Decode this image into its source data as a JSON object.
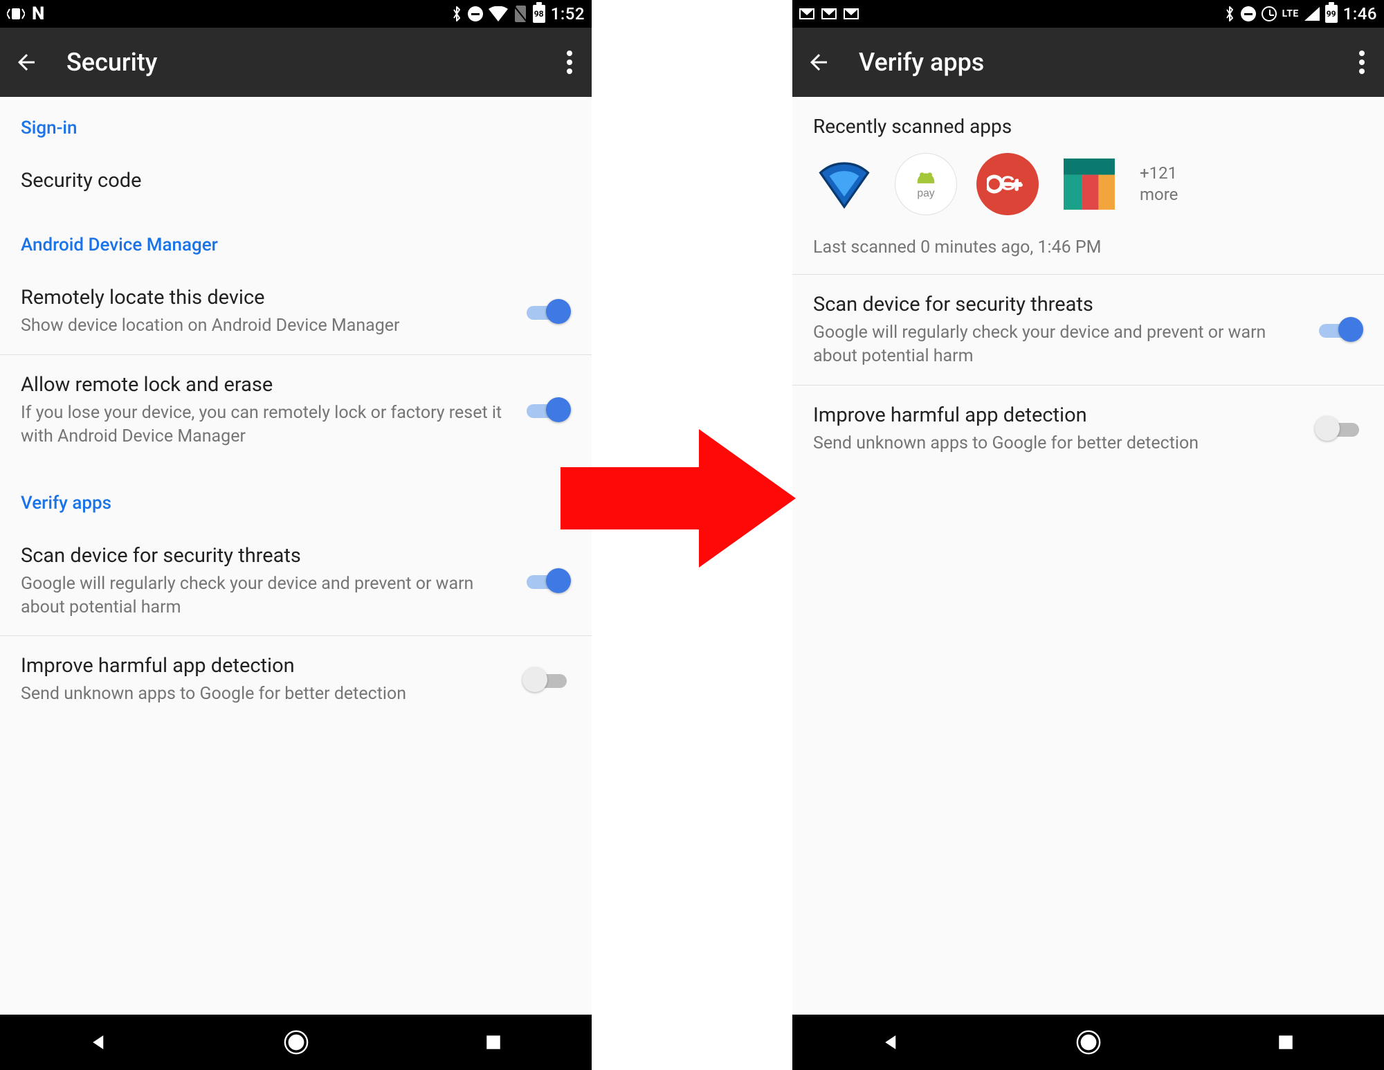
{
  "left": {
    "status": {
      "time": "1:52",
      "battery_pct": "98"
    },
    "title": "Security",
    "sections": {
      "signin_header": "Sign-in",
      "security_code": "Security code",
      "adm_header": "Android Device Manager",
      "remote_locate_title": "Remotely locate this device",
      "remote_locate_sub": "Show device location on Android Device Manager",
      "remote_lock_title": "Allow remote lock and erase",
      "remote_lock_sub": "If you lose your device, you can remotely lock or factory reset it with Android Device Manager",
      "verify_header": "Verify apps",
      "scan_title": "Scan device for security threats",
      "scan_sub": "Google will regularly check your device and prevent or warn about potential harm",
      "improve_title": "Improve harmful app detection",
      "improve_sub": "Send unknown apps to Google for better detection"
    }
  },
  "right": {
    "status": {
      "time": "1:46",
      "battery_pct": "99",
      "network": "LTE"
    },
    "title": "Verify apps",
    "recent_header": "Recently scanned apps",
    "more_apps_count": "+121",
    "more_apps_label": "more",
    "last_scanned": "Last scanned 0 minutes ago, 1:46 PM",
    "scan_title": "Scan device for security threats",
    "scan_sub": "Google will regularly check your device and prevent or warn about potential harm",
    "improve_title": "Improve harmful app detection",
    "improve_sub": "Send unknown apps to Google for better detection"
  },
  "toggles": {
    "left_locate": true,
    "left_lock": true,
    "left_scan": true,
    "left_improve": false,
    "right_scan": true,
    "right_improve": false
  },
  "colors": {
    "accent": "#1a73e8",
    "arrow": "#ff0808ff",
    "gplus": "#db4437",
    "wifi_app": "#1565c0"
  }
}
